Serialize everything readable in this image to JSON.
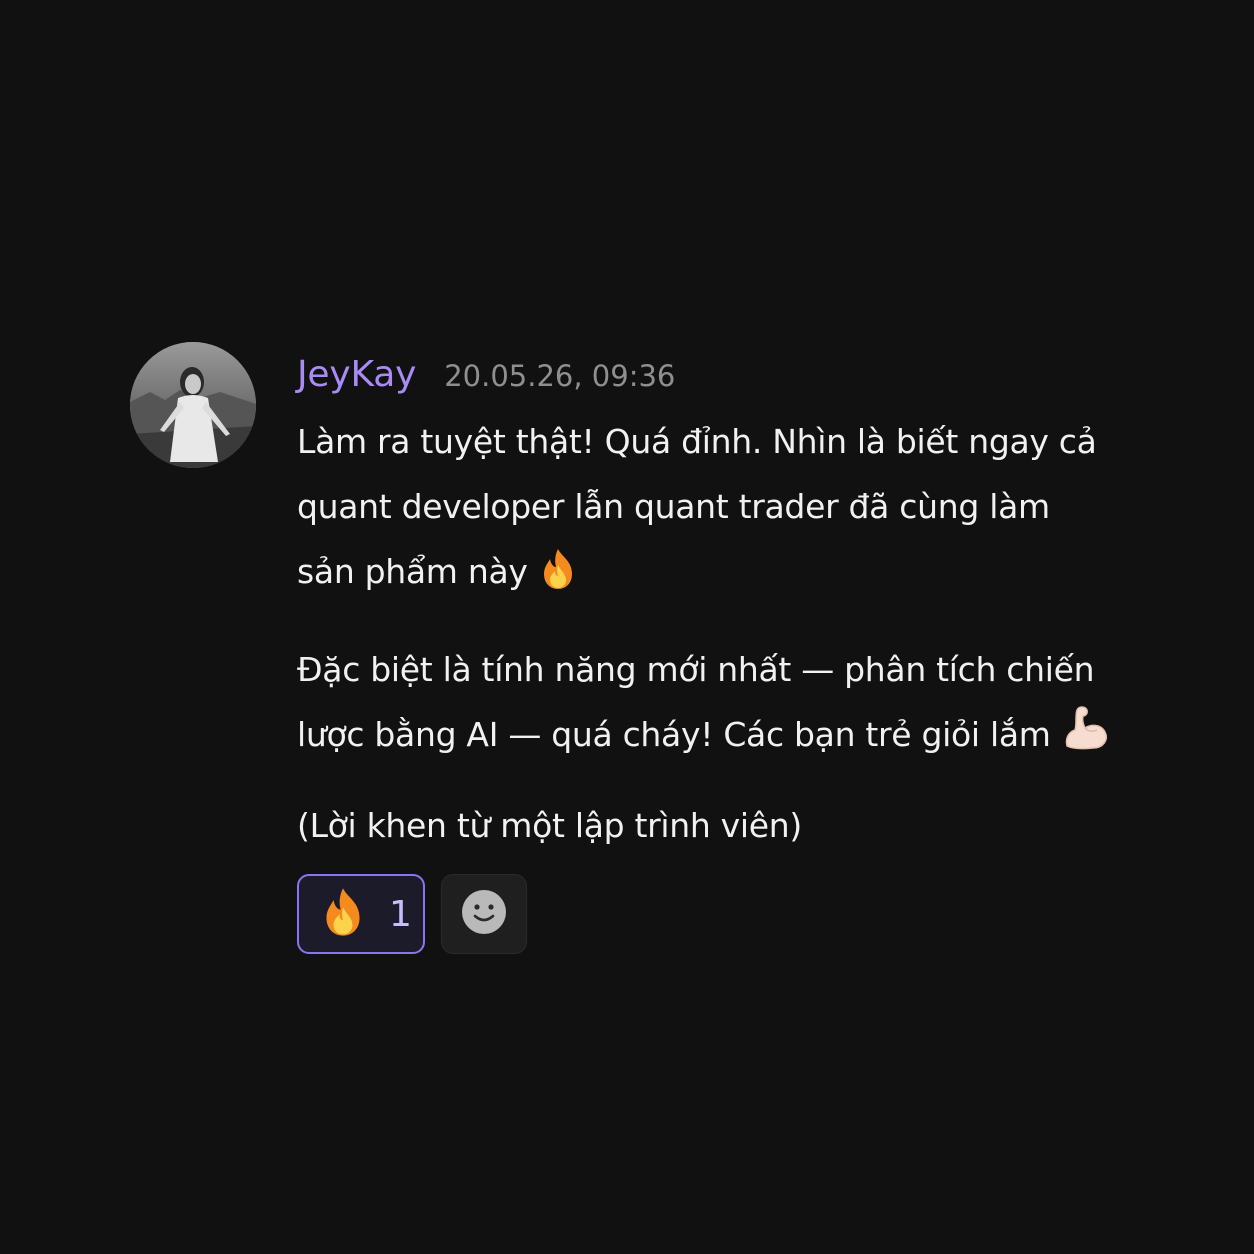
{
  "message": {
    "author": "JeyKay",
    "timestamp": "20.05.26, 09:36",
    "paragraph1": "Làm ra tuyệt thật! Quá đỉnh. Nhìn là biết ngay cả quant developer lẫn quant trader đã cùng làm sản phẩm này",
    "paragraph1_emoji": "fire-icon",
    "paragraph2": "Đặc biệt là tính năng mới nhất — phân tích chiến lược bằng AI — quá cháy! Các bạn trẻ giỏi lắm",
    "paragraph2_emoji": "flexed-biceps-icon",
    "paragraph3": "(Lời khen từ một lập trình viên)"
  },
  "reactions": [
    {
      "icon": "fire-icon",
      "count": "1"
    }
  ],
  "add_reaction_icon": "smiley-icon",
  "colors": {
    "background": "#111111",
    "author": "#a98bf5",
    "timestamp": "#8f8f8f",
    "text": "#f1f1f1",
    "reaction_border": "#8a75f0"
  }
}
